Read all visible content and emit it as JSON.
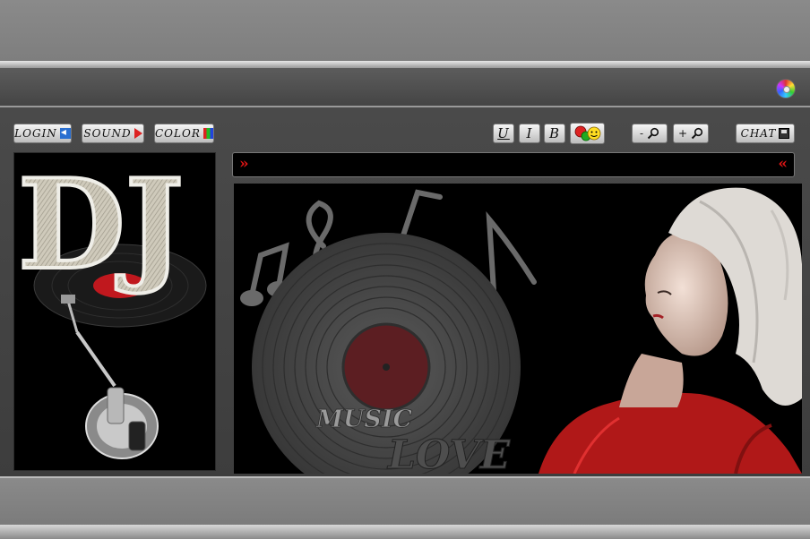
{
  "toolbar": {
    "login_label": "LOGIN",
    "sound_label": "SOUND",
    "color_label": "COLOR",
    "underline_label": "U",
    "italic_label": "I",
    "bold_label": "B",
    "zoom_out_label": "-",
    "zoom_in_label": "+",
    "chat_label": "CHAT"
  },
  "marquee": {
    "left_arrow": "»",
    "right_arrow": "«"
  },
  "sidebar": {
    "logo_text": "DJ"
  },
  "banner": {
    "word1": "MUSIC",
    "word2": "LOVE"
  },
  "colors": {
    "arrow_red": "#e01515",
    "record_label_red": "#c0181e",
    "dress_red": "#b01818"
  }
}
